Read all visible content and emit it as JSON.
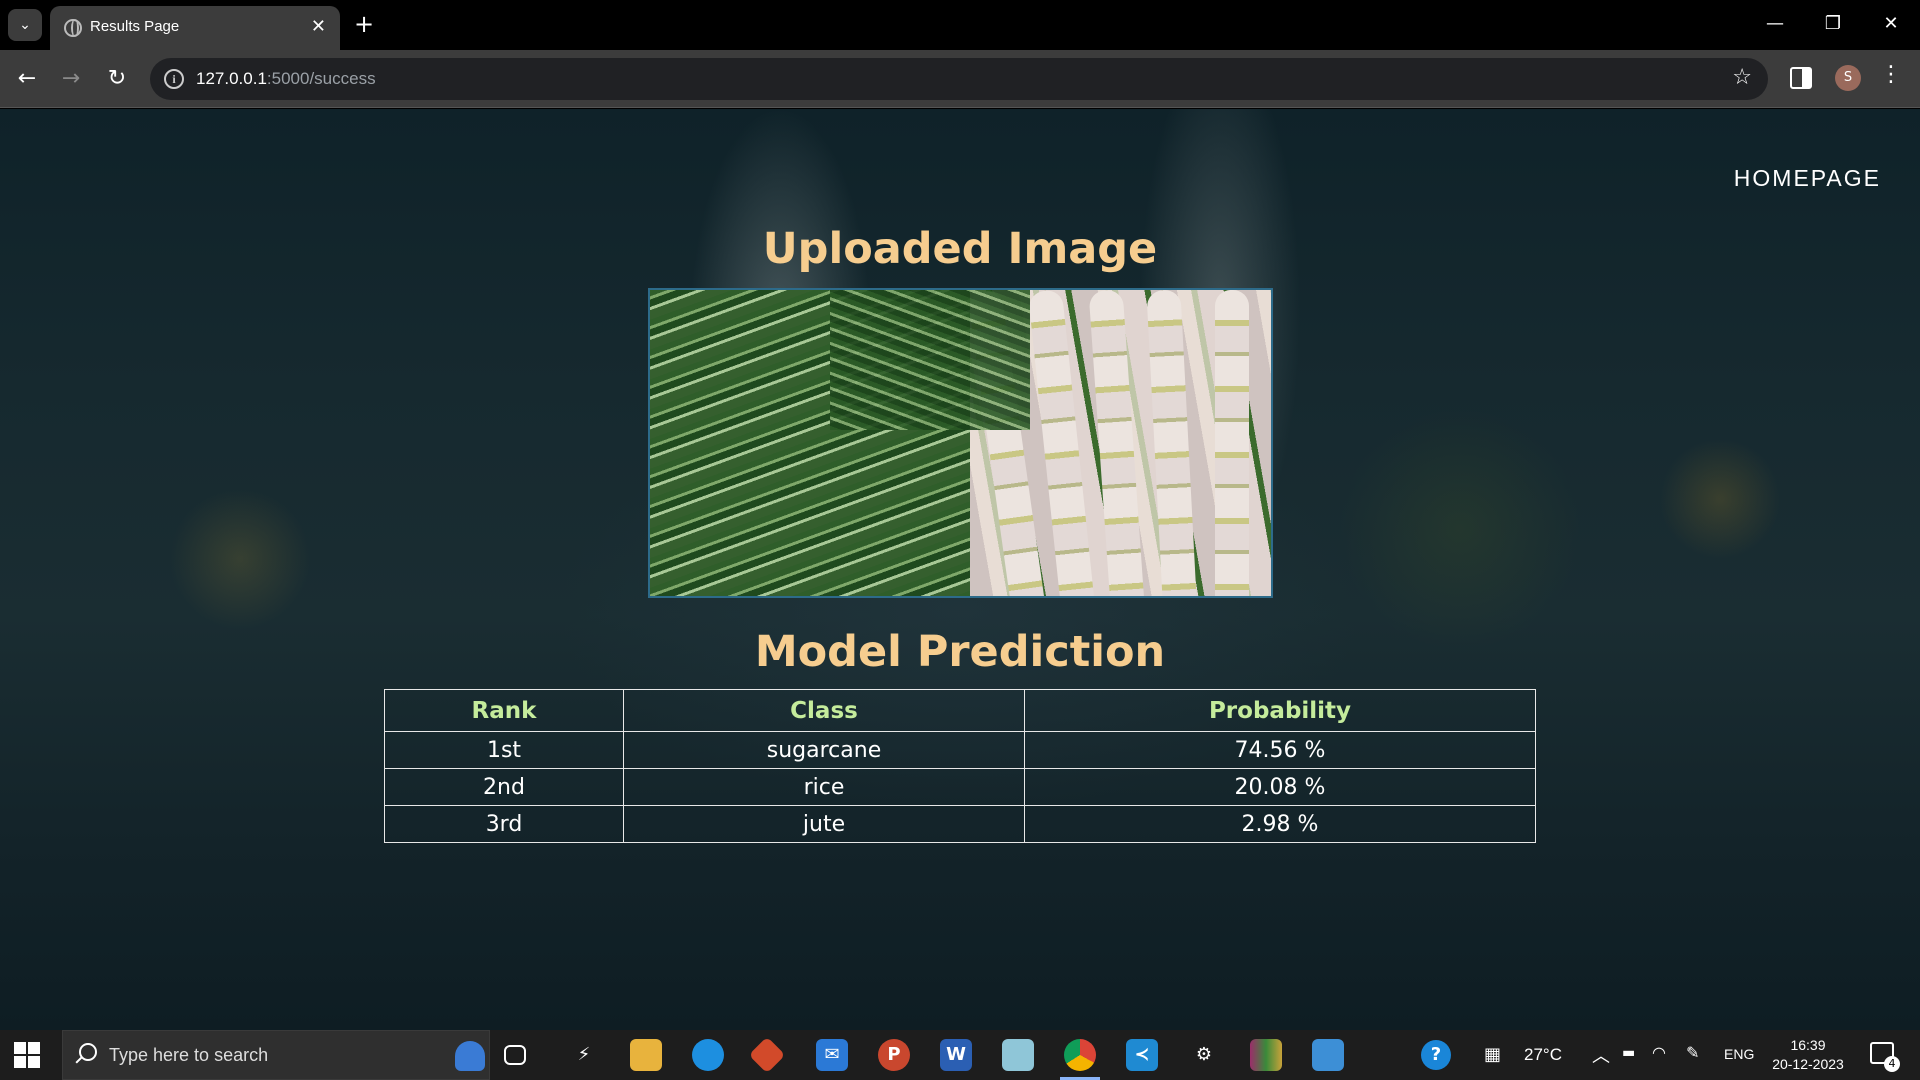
{
  "browser": {
    "tab_title": "Results Page",
    "url_host": "127.0.0.1",
    "url_path": ":5000/success",
    "avatar_initial": "S"
  },
  "page": {
    "nav_link": "HOMEPAGE",
    "uploaded_heading": "Uploaded Image",
    "prediction_heading": "Model Prediction",
    "table": {
      "headers": [
        "Rank",
        "Class",
        "Probability"
      ],
      "rows": [
        [
          "1st",
          "sugarcane",
          "74.56 %"
        ],
        [
          "2nd",
          "rice",
          "20.08 %"
        ],
        [
          "3rd",
          "jute",
          "2.98 %"
        ]
      ]
    }
  },
  "taskbar": {
    "search_placeholder": "Type here to search",
    "weather": "27°C",
    "language": "ENG",
    "time": "16:39",
    "date": "20-12-2023",
    "notification_count": "4",
    "apps": [
      "task-view-icon",
      "git-icon",
      "file-explorer-icon",
      "edge-icon",
      "git-gui-icon",
      "mail-icon",
      "powerpoint-icon",
      "word-icon",
      "notepad-icon",
      "chrome-icon",
      "vscode-icon",
      "settings-icon",
      "winrar-icon",
      "photos-icon"
    ]
  },
  "colors": {
    "heading": "#f6cd8f",
    "table_header": "#c5ec9c",
    "accent": "#8ab4f8"
  }
}
